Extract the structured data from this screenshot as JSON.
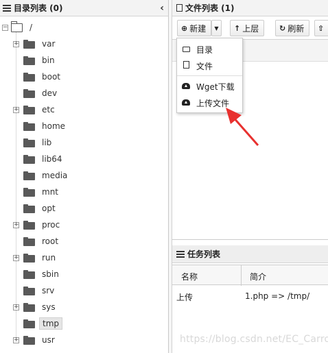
{
  "dir_panel": {
    "title": "目录列表 (0)",
    "collapse_glyph": "‹"
  },
  "tree": {
    "root": "/",
    "items": [
      {
        "label": "var",
        "expandable": true
      },
      {
        "label": "bin",
        "expandable": false
      },
      {
        "label": "boot",
        "expandable": false
      },
      {
        "label": "dev",
        "expandable": false
      },
      {
        "label": "etc",
        "expandable": true
      },
      {
        "label": "home",
        "expandable": false
      },
      {
        "label": "lib",
        "expandable": false
      },
      {
        "label": "lib64",
        "expandable": false
      },
      {
        "label": "media",
        "expandable": false
      },
      {
        "label": "mnt",
        "expandable": false
      },
      {
        "label": "opt",
        "expandable": false
      },
      {
        "label": "proc",
        "expandable": true
      },
      {
        "label": "root",
        "expandable": false
      },
      {
        "label": "run",
        "expandable": true
      },
      {
        "label": "sbin",
        "expandable": false
      },
      {
        "label": "srv",
        "expandable": false
      },
      {
        "label": "sys",
        "expandable": true
      },
      {
        "label": "tmp",
        "expandable": false,
        "selected": true
      },
      {
        "label": "usr",
        "expandable": true
      }
    ]
  },
  "file_panel": {
    "title": "文件列表 (1)"
  },
  "toolbar": {
    "new_label": "新建",
    "up_label": "上层",
    "refresh_label": "刷新"
  },
  "new_menu": {
    "items": [
      {
        "label": "目录",
        "icon": "folder-icon"
      },
      {
        "label": "文件",
        "icon": "file-icon"
      },
      {
        "label": "Wget下载",
        "icon": "cloud-download-icon"
      },
      {
        "label": "上传文件",
        "icon": "cloud-upload-icon"
      }
    ]
  },
  "task_panel": {
    "title": "任务列表",
    "columns": [
      "名称",
      "简介"
    ],
    "rows": [
      {
        "name": "上传",
        "desc": "1.php => /tmp/"
      }
    ]
  },
  "watermark": "https://blog.csdn.net/EC_Carrot",
  "colors": {
    "arrow": "#e8312f",
    "selected_bg": "#e6e6e6",
    "header_bg": "#f3f3f3"
  }
}
